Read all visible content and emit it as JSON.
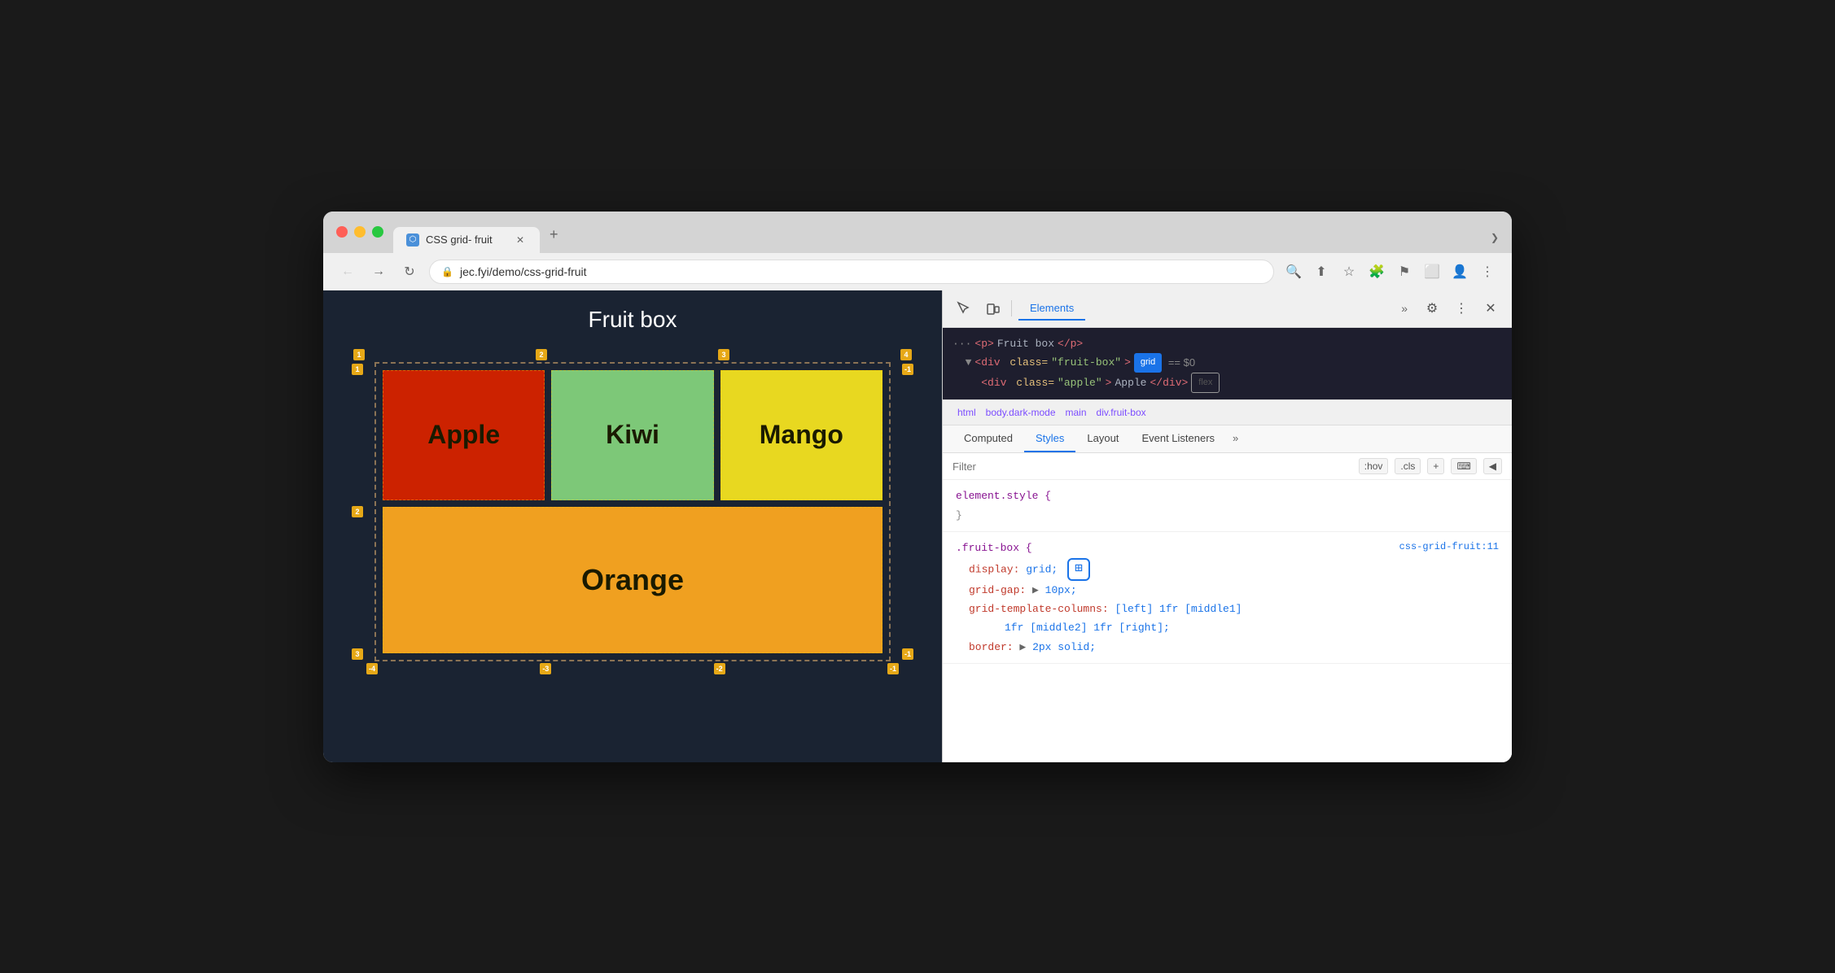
{
  "browser": {
    "tab_title": "CSS grid- fruit",
    "tab_favicon": "⬡",
    "url": "jec.fyi/demo/css-grid-fruit",
    "new_tab_label": "+",
    "more_tabs_label": "❯"
  },
  "webpage": {
    "title": "Fruit box",
    "fruits": [
      {
        "name": "Apple",
        "color": "#cc2200"
      },
      {
        "name": "Kiwi",
        "color": "#7dc878"
      },
      {
        "name": "Mango",
        "color": "#e8d820"
      },
      {
        "name": "Orange",
        "color": "#f0a020"
      }
    ],
    "grid_numbers_top": [
      "1",
      "2",
      "3",
      "4"
    ],
    "grid_numbers_left": [
      "1",
      "2",
      "3"
    ],
    "grid_numbers_bottom": [
      "-4",
      "-3",
      "-2",
      "-1"
    ],
    "grid_numbers_right": [
      "-1"
    ]
  },
  "devtools": {
    "toolbar": {
      "tabs": [
        "Elements",
        ""
      ],
      "more_label": "»",
      "gear_label": "⚙",
      "kebab_label": "⋮",
      "close_label": "✕"
    },
    "html": {
      "line1": "<p>Fruit box</p>",
      "line2_pre": "<div class=\"fruit-box\">",
      "grid_badge": "grid",
      "eq_sign": "==",
      "dollar_zero": "$0",
      "line3_pre": "<div class=\"apple\">Apple</div>",
      "flex_badge": "flex"
    },
    "breadcrumb": {
      "items": [
        "html",
        "body.dark-mode",
        "main",
        "div.fruit-box"
      ]
    },
    "panel_tabs": {
      "items": [
        "Computed",
        "Styles",
        "Layout",
        "Event Listeners"
      ],
      "more_label": "»",
      "active": "Styles"
    },
    "filter": {
      "placeholder": "Filter",
      "hov_label": ":hov",
      "cls_label": ".cls",
      "plus_label": "+",
      "toggle_label": "⌨",
      "back_label": "◀"
    },
    "styles": {
      "rule1": {
        "selector": "element.style {",
        "closing": "}"
      },
      "rule2": {
        "selector": ".fruit-box {",
        "source": "css-grid-fruit:11",
        "properties": [
          {
            "prop": "display:",
            "val": "grid;",
            "extra": "grid-icon"
          },
          {
            "prop": "grid-gap:",
            "val": "▶ 10px;",
            "arrow": true
          },
          {
            "prop": "grid-template-columns:",
            "val": "[left] 1fr [middle1]",
            "cont": "1fr [middle2] 1fr [right];"
          },
          {
            "prop": "border:",
            "val": "▶ 2px solid;",
            "arrow": true
          }
        ],
        "closing": ""
      }
    }
  }
}
